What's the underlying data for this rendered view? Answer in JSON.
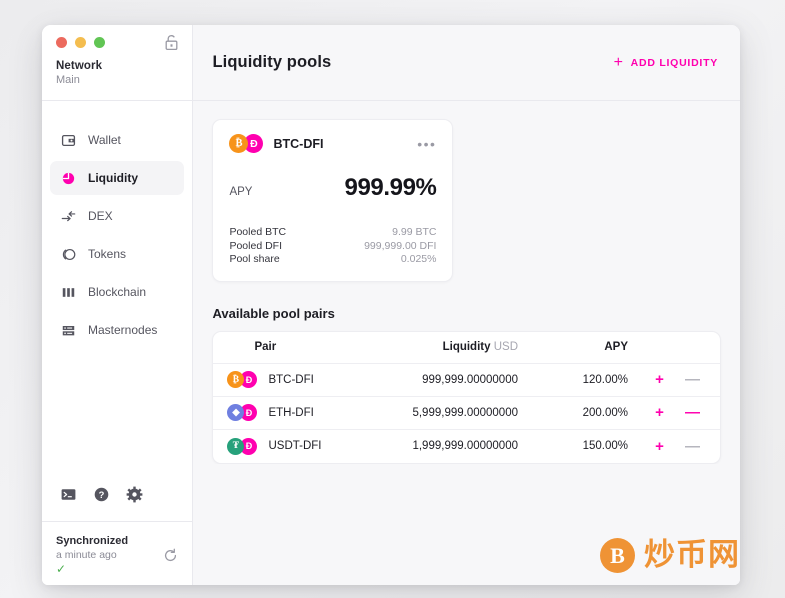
{
  "window": {
    "traffic_lights": [
      "close",
      "minimize",
      "zoom"
    ],
    "lock_icon": "unlocked-padlock-icon"
  },
  "sidebar": {
    "network_label": "Network",
    "network_value": "Main",
    "items": [
      {
        "label": "Wallet",
        "icon": "wallet-icon",
        "active": false
      },
      {
        "label": "Liquidity",
        "icon": "liquidity-pie-icon",
        "active": true
      },
      {
        "label": "DEX",
        "icon": "dex-arrows-icon",
        "active": false
      },
      {
        "label": "Tokens",
        "icon": "tokens-icon",
        "active": false
      },
      {
        "label": "Blockchain",
        "icon": "blockchain-bars-icon",
        "active": false
      },
      {
        "label": "Masternodes",
        "icon": "masternodes-server-icon",
        "active": false
      }
    ],
    "tools": [
      {
        "icon": "terminal-icon"
      },
      {
        "icon": "help-circle-icon"
      },
      {
        "icon": "gear-icon"
      }
    ],
    "status": {
      "title": "Synchronized",
      "time": "a minute ago",
      "check": "✓",
      "refresh_icon": "refresh-icon"
    }
  },
  "header": {
    "title": "Liquidity pools",
    "add_liquidity_label": "ADD LIQUIDITY",
    "add_liquidity_icon": "plus-icon"
  },
  "pool_card": {
    "pair": "BTC-DFI",
    "coin_a": "₿",
    "coin_b": "Ð",
    "menu_icon": "more-horizontal-icon",
    "apy_label": "APY",
    "apy_value": "999.99%",
    "stats": [
      {
        "label": "Pooled BTC",
        "value": "9.99 BTC"
      },
      {
        "label": "Pooled DFI",
        "value": "999,999.00 DFI"
      },
      {
        "label": "Pool share",
        "value": "0.025%"
      }
    ]
  },
  "pool_table": {
    "section_title": "Available pool pairs",
    "columns": {
      "pair": "Pair",
      "liquidity": "Liquidity",
      "liquidity_unit": "USD",
      "apy": "APY"
    },
    "rows": [
      {
        "pair": "BTC-DFI",
        "coin_a": "₿",
        "coin_b": "Ð",
        "coin_a_class": "btc",
        "liquidity": "999,999.00000000",
        "apy": "120.00%",
        "plus": "+",
        "minus": "—",
        "minus_active": false
      },
      {
        "pair": "ETH-DFI",
        "coin_a": "◆",
        "coin_b": "Ð",
        "coin_a_class": "eth",
        "liquidity": "5,999,999.00000000",
        "apy": "200.00%",
        "plus": "+",
        "minus": "—",
        "minus_active": true
      },
      {
        "pair": "USDT-DFI",
        "coin_a": "₮",
        "coin_b": "Ð",
        "coin_a_class": "usdt",
        "liquidity": "1,999,999.00000000",
        "apy": "150.00%",
        "plus": "+",
        "minus": "—",
        "minus_active": false
      }
    ]
  },
  "watermark": {
    "badge": "B",
    "text": "炒币网"
  },
  "colors": {
    "accent_magenta": "#ff00af",
    "btc_orange": "#f7931a",
    "eth_blue": "#6f7fe0",
    "usdt_green": "#26a17b",
    "watermark_orange": "#ef8e2b",
    "sync_green": "#4caf50"
  }
}
